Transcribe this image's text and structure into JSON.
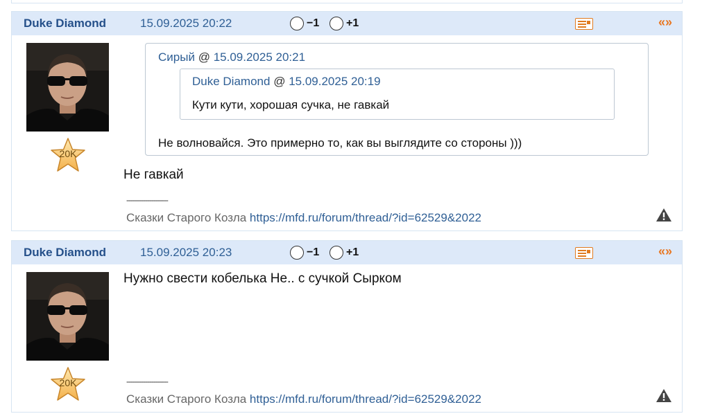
{
  "posts": [
    {
      "author": "Duke Diamond",
      "timestamp": "15.09.2025 20:22",
      "vote_minus": "−1",
      "vote_plus": "+1",
      "quote_icon": "«»",
      "rating_badge": "20K",
      "quote": {
        "author": "Сирый",
        "at": "@",
        "timestamp": "15.09.2025 20:21",
        "text": "Не волновайся. Это примерно то, как вы выглядите со стороны )))",
        "nested_quote": {
          "author": "Duke Diamond",
          "at": "@",
          "timestamp": "15.09.2025 20:19",
          "text": "Кути кути, хорошая сучка, не гавкай"
        }
      },
      "body": "Не гавкай",
      "signature": {
        "separator": "--------------------",
        "label": "Сказки Старого Козла",
        "link": "https://mfd.ru/forum/thread/?id=62529&2022"
      }
    },
    {
      "author": "Duke Diamond",
      "timestamp": "15.09.2025 20:23",
      "vote_minus": "−1",
      "vote_plus": "+1",
      "quote_icon": "«»",
      "rating_badge": "20K",
      "body": "Нужно свести кобелька Не.. с сучкой Сырком",
      "signature": {
        "separator": "--------------------",
        "label": "Сказки Старого Козла",
        "link": "https://mfd.ru/forum/thread/?id=62529&2022"
      }
    }
  ],
  "icons": {
    "private_message": "envelope-card-icon",
    "quote": "quote-icon",
    "report": "warning-triangle-icon",
    "rating": "star-icon"
  },
  "colors": {
    "header_bg": "#dde9f9",
    "author": "#25508a",
    "link": "#2f5f95",
    "accent": "#e87722"
  }
}
